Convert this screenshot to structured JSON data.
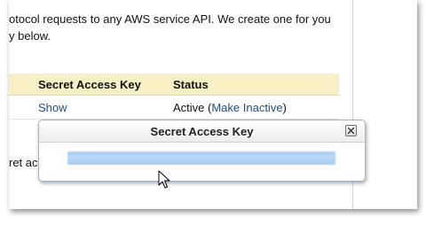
{
  "intro": {
    "line1": "otocol requests to any AWS service API. We create one for you",
    "line2": "y below."
  },
  "table": {
    "headers": {
      "secret_key": "Secret Access Key",
      "status": "Status"
    },
    "row": {
      "show_link": "Show",
      "status_text": "Active (",
      "status_action": "Make Inactive",
      "status_close": ")"
    }
  },
  "trailing_text": "ret ac",
  "modal": {
    "title": "Secret Access Key",
    "key_value_visibility": "redacted (blurred highlight)"
  },
  "icons": {
    "close": "close-icon",
    "cursor": "arrow-cursor-icon"
  },
  "colors": {
    "table_header_bg": "#f7f0c6",
    "link": "#1a4f8a",
    "modal_border": "#9fb5cc",
    "redaction_blue": "#b9d8f6"
  }
}
